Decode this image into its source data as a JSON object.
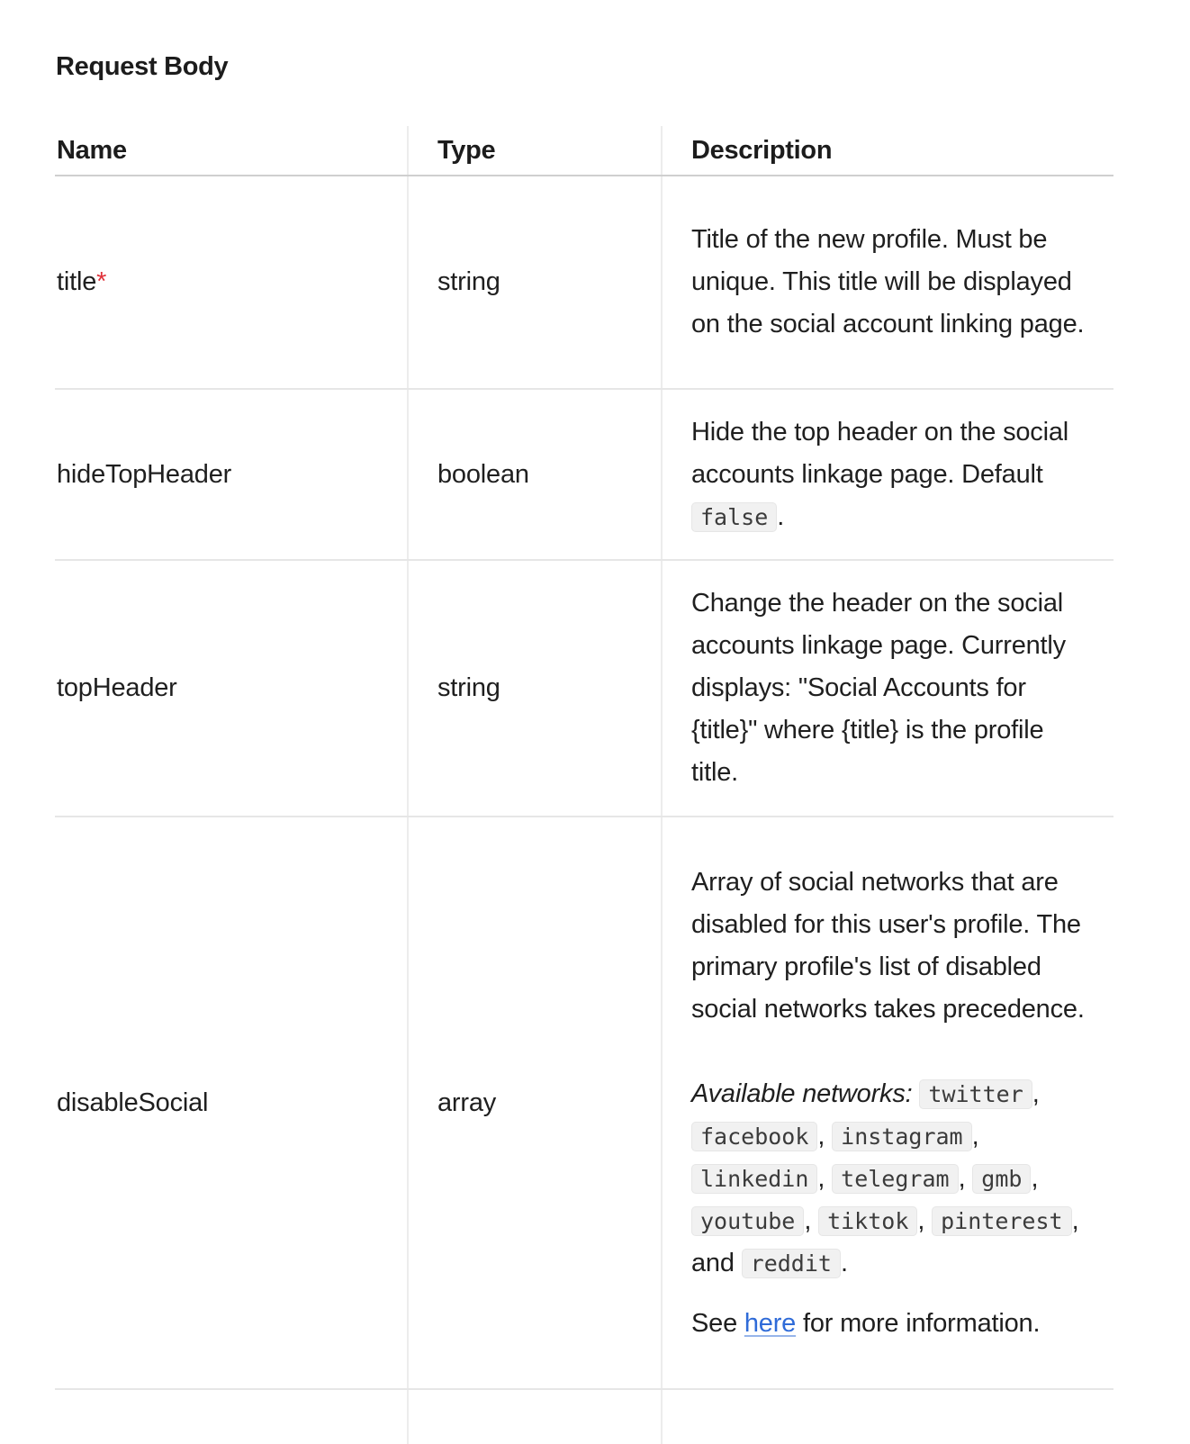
{
  "section_title": "Request Body",
  "table": {
    "headers": {
      "name": "Name",
      "type": "Type",
      "description": "Description"
    },
    "required_marker": "*",
    "rows": [
      {
        "name": "title",
        "required": true,
        "type": "string",
        "description": "Title of the new profile. Must be unique. This title will be displayed on the social account linking page."
      },
      {
        "name": "hideTopHeader",
        "required": false,
        "type": "boolean",
        "description_prefix": "Hide the top header on the social accounts linkage page. Default ",
        "default_code": "false",
        "description_suffix": "."
      },
      {
        "name": "topHeader",
        "required": false,
        "type": "string",
        "description": "Change the header on the social accounts linkage page. Currently displays: \"Social Accounts for {title}\" where {title} is the profile title."
      },
      {
        "name": "disableSocial",
        "required": false,
        "type": "array",
        "description": "Array of social networks that are disabled for this user's profile. The primary profile's list of disabled social networks takes precedence.",
        "networks_label": "Available networks:",
        "networks": [
          "twitter",
          "facebook",
          "instagram",
          "linkedin",
          "telegram",
          "gmb",
          "youtube",
          "tiktok",
          "pinterest",
          "reddit"
        ],
        "separator": ",",
        "last_joiner": ", and",
        "end_punct": ".",
        "see_prefix": "See ",
        "see_link": "here",
        "see_suffix": " for more information."
      }
    ]
  },
  "colors": {
    "required": "#e0323a",
    "link": "#2f6bd8",
    "code_bg": "#f1f1f1"
  }
}
